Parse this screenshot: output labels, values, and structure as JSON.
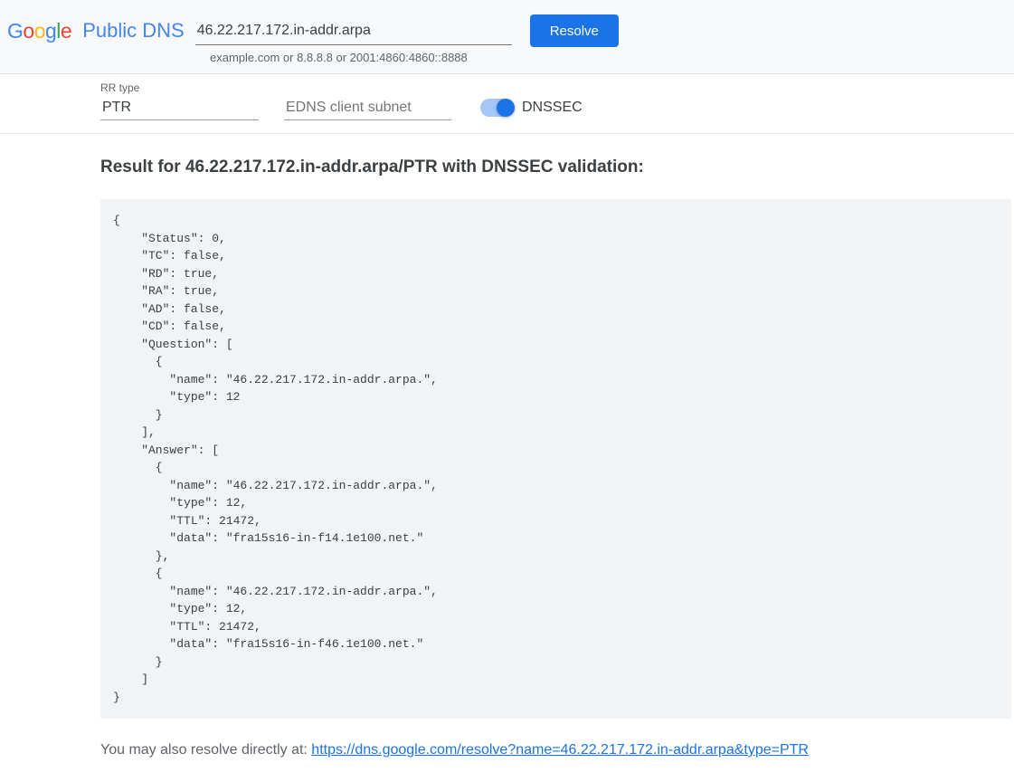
{
  "header": {
    "product": "Public DNS",
    "domain_value": "46.22.217.172.in-addr.arpa",
    "hint": "example.com or 8.8.8.8 or 2001:4860:4860::8888",
    "resolve_label": "Resolve"
  },
  "query": {
    "rr_label": "RR type",
    "rr_value": "PTR",
    "edns_placeholder": "EDNS client subnet",
    "dnssec_label": "DNSSEC"
  },
  "result": {
    "heading": "Result for 46.22.217.172.in-addr.arpa/PTR with DNSSEC validation:",
    "json": "{\n    \"Status\": 0,\n    \"TC\": false,\n    \"RD\": true,\n    \"RA\": true,\n    \"AD\": false,\n    \"CD\": false,\n    \"Question\": [\n      {\n        \"name\": \"46.22.217.172.in-addr.arpa.\",\n        \"type\": 12\n      }\n    ],\n    \"Answer\": [\n      {\n        \"name\": \"46.22.217.172.in-addr.arpa.\",\n        \"type\": 12,\n        \"TTL\": 21472,\n        \"data\": \"fra15s16-in-f14.1e100.net.\"\n      },\n      {\n        \"name\": \"46.22.217.172.in-addr.arpa.\",\n        \"type\": 12,\n        \"TTL\": 21472,\n        \"data\": \"fra15s16-in-f46.1e100.net.\"\n      }\n    ]\n}"
  },
  "footer": {
    "prefix": "You may also resolve directly at: ",
    "link_text": "https://dns.google.com/resolve?name=46.22.217.172.in-addr.arpa&type=PTR"
  }
}
